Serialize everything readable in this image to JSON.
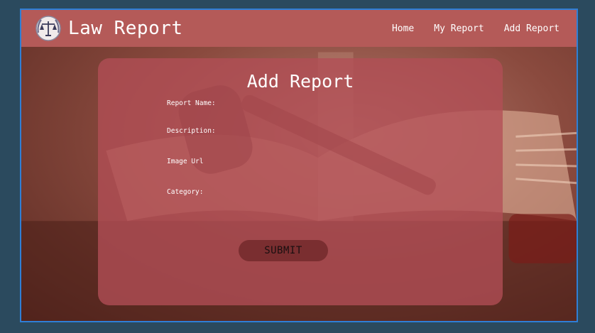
{
  "app": {
    "title": "Law Report"
  },
  "nav": {
    "home": "Home",
    "my_report": "My Report",
    "add_report": "Add Report"
  },
  "form": {
    "title": "Add Report",
    "report_name_label": "Report Name:",
    "description_label": "Description:",
    "image_url_label": "Image Url",
    "category_label": "Category:",
    "submit_label": "SUBMIT"
  },
  "icons": {
    "logo": "scales-of-justice-wreath-icon"
  },
  "colors": {
    "navbar": "#b45a58",
    "card": "#b24e56",
    "submit": "#7a2e30",
    "frame_border": "#2f7fd6"
  }
}
